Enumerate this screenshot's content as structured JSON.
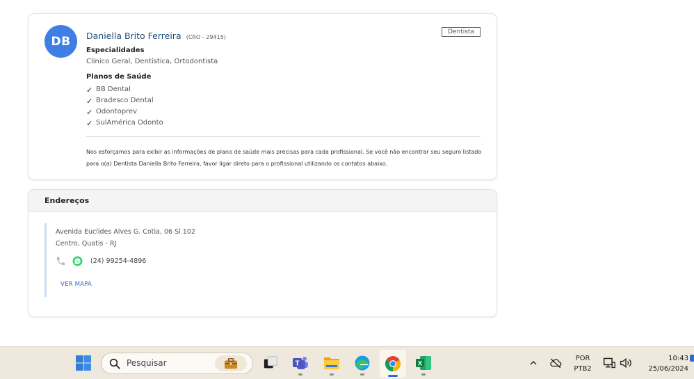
{
  "profile": {
    "initials": "DB",
    "name": "Daniella Brito Ferreira",
    "registration": "(CRO - 29415)",
    "badge": "Dentista",
    "specialties_title": "Especialidades",
    "specialties": "Clínico Geral, Dentística, Ortodontista",
    "plans_title": "Planos de Saúde",
    "plans": [
      "BB Dental",
      "Bradesco Dental",
      "Odontoprev",
      "SulAmérica Odonto"
    ],
    "disclaimer": "Nos esforçamos para exibir as informações de plano de saúde mais precisas para cada profissional. Se você não encontrar seu seguro listado para o(a) Dentista Daniella Brito Ferreira, favor ligar direto para o profissional utilizando os contatos abaixo."
  },
  "addresses": {
    "title": "Endereços",
    "items": [
      {
        "street": "Avenida Euclides Alves G. Cotia, 06 Sl 102",
        "district": "Centro, Quatis - RJ",
        "phone": "(24) 99254-4896",
        "map_label": "VER MAPA"
      }
    ]
  },
  "taskbar": {
    "search_placeholder": "Pesquisar",
    "language_top": "POR",
    "language_bottom": "PTB2",
    "time": "10:43",
    "date": "25/06/2024"
  },
  "colors": {
    "avatar": "#3f7fe3",
    "name": "#1e4d78",
    "link": "#2a66c9",
    "whatsapp": "#25d366",
    "accent_bar": "#c7dcf3"
  }
}
